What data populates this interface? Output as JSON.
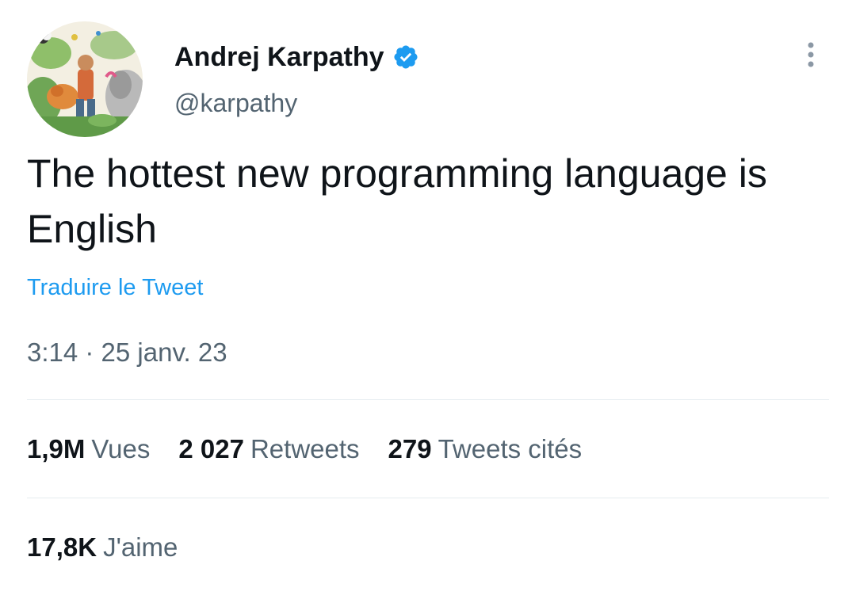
{
  "author": {
    "display_name": "Andrej Karpathy",
    "handle": "@karpathy",
    "verified": true,
    "avatar_icon": "illustrated-jungle-avatar"
  },
  "tweet": {
    "text": "The hottest new programming language is English",
    "translate_label": "Traduire le Tweet",
    "timestamp": "3:14 · 25 janv. 23"
  },
  "stats": {
    "views": {
      "count": "1,9M",
      "label": "Vues"
    },
    "retweets": {
      "count": "2 027",
      "label": "Retweets"
    },
    "quotes": {
      "count": "279",
      "label": "Tweets cités"
    },
    "likes": {
      "count": "17,8K",
      "label": "J'aime"
    }
  },
  "colors": {
    "accent": "#1d9bf0",
    "secondary_text": "#536471",
    "primary_text": "#0f1419",
    "divider": "#e6ecf0"
  },
  "icons": {
    "verified": "verified-badge-icon",
    "more": "more-options-icon"
  }
}
